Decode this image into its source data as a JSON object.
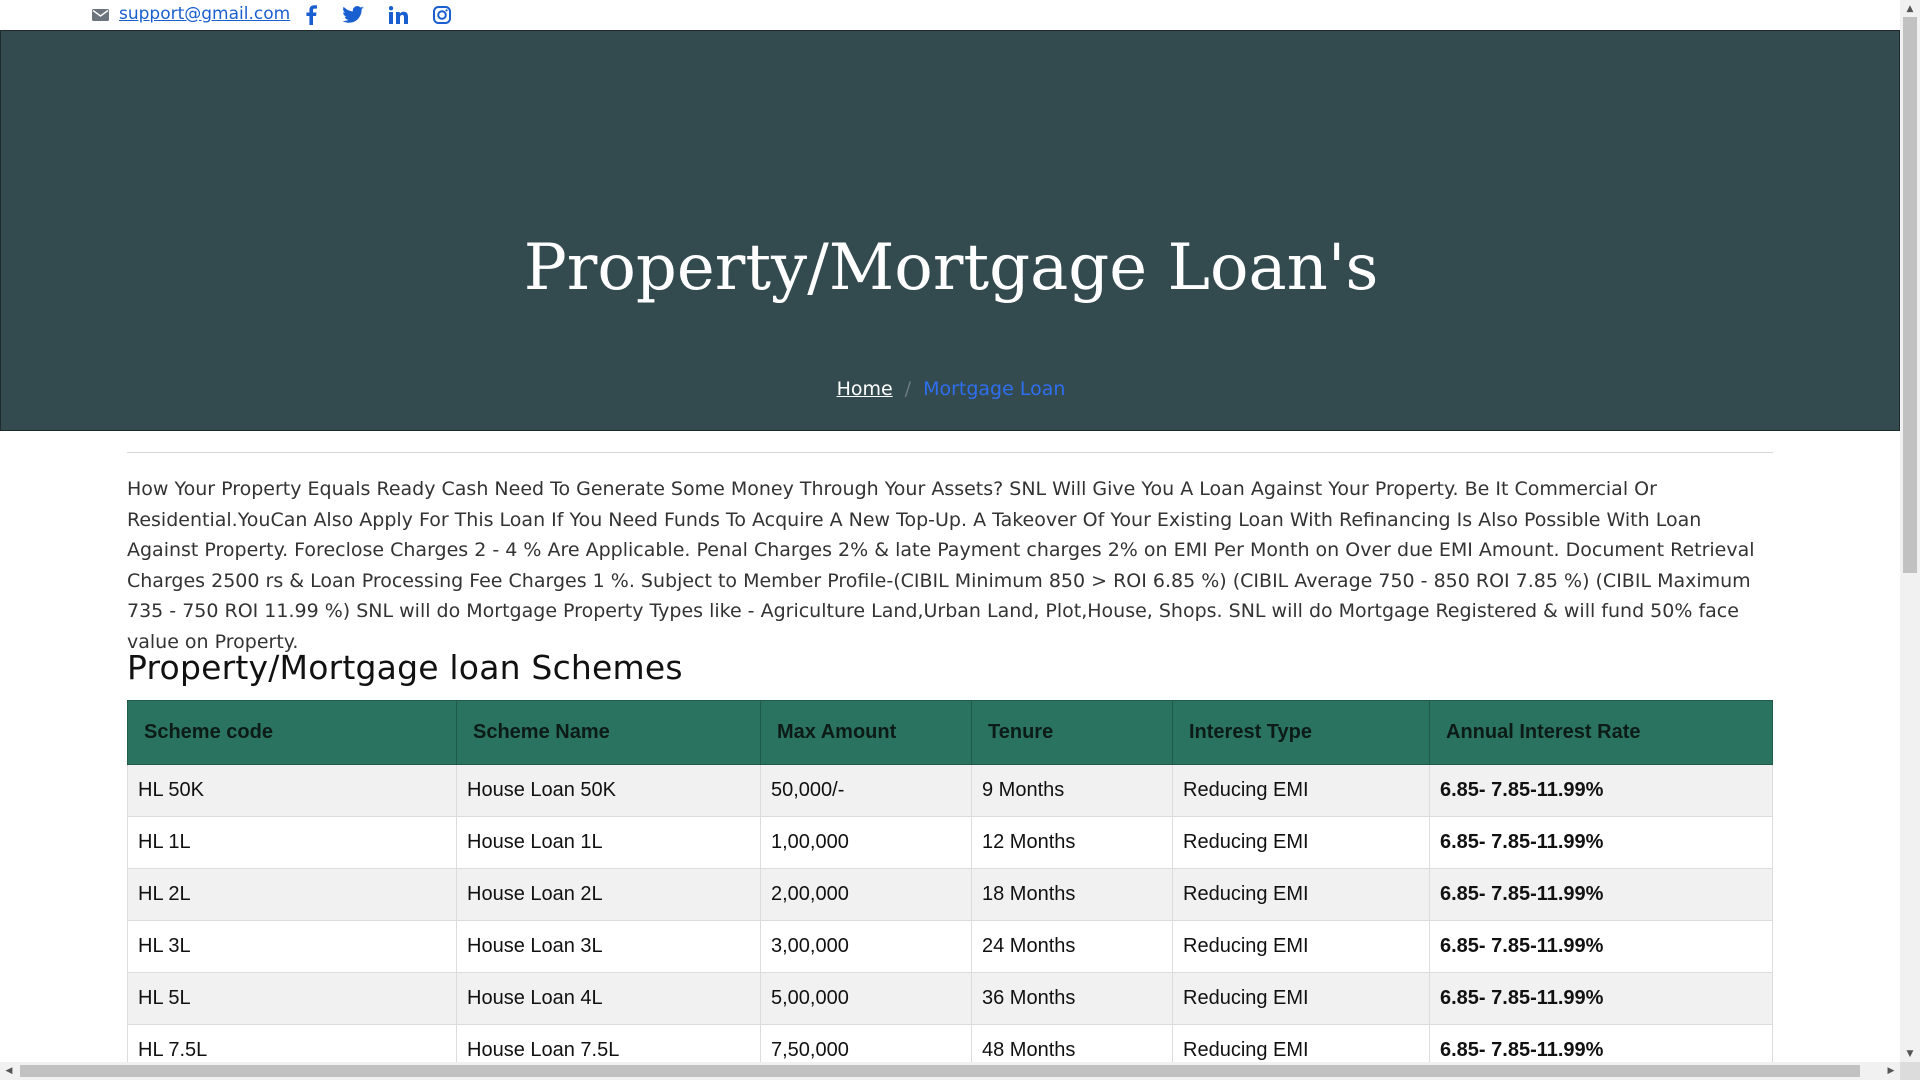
{
  "topbar": {
    "email": "support@gmail.com",
    "social": [
      "facebook-icon",
      "twitter-icon",
      "linkedin-icon",
      "instagram-icon"
    ]
  },
  "hero": {
    "title": "Property/Mortgage Loan's",
    "breadcrumb": {
      "home": "Home",
      "separator": "/",
      "current": "Mortgage Loan"
    },
    "background": "#334a4f"
  },
  "intro": "How Your Property Equals Ready Cash Need To Generate Some Money Through Your Assets? SNL Will Give You A Loan Against Your Property. Be It Commercial Or Residential.YouCan Also Apply For This Loan If You Need Funds To Acquire A New Top-Up. A Takeover Of Your Existing Loan With Refinancing Is Also Possible With Loan Against Property. Foreclose Charges 2 - 4 % Are Applicable. Penal Charges 2% & late Payment charges 2% on EMI Per Month on Over due EMI Amount. Document Retrieval Charges 2500 rs & Loan Processing Fee Charges 1 %. Subject to Member Profile-(CIBIL Minimum 850 > ROI 6.85 %) (CIBIL Average 750 - 850 ROI 7.85 %) (CIBIL Maximum 735 - 750 ROI 11.99 %) SNL will do Mortgage Property Types like - Agriculture Land,Urban Land, Plot,House, Shops. SNL will do Mortgage Registered & will fund 50% face value on Property.",
  "schemes": {
    "title": "Property/Mortgage loan Schemes",
    "header_color": "#2a7360",
    "columns": [
      "Scheme code",
      "Scheme Name",
      "Max Amount",
      "Tenure",
      "Interest Type",
      "Annual Interest Rate"
    ],
    "rows": [
      [
        "HL 50K",
        "House Loan 50K",
        "50,000/-",
        "9 Months",
        "Reducing EMI",
        "6.85- 7.85-11.99%"
      ],
      [
        "HL 1L",
        "House Loan 1L",
        "1,00,000",
        "12 Months",
        "Reducing EMI",
        "6.85- 7.85-11.99%"
      ],
      [
        "HL 2L",
        "House Loan 2L",
        "2,00,000",
        "18 Months",
        "Reducing EMI",
        "6.85- 7.85-11.99%"
      ],
      [
        "HL 3L",
        "House Loan 3L",
        "3,00,000",
        "24 Months",
        "Reducing EMI",
        "6.85- 7.85-11.99%"
      ],
      [
        "HL 5L",
        "House Loan 4L",
        "5,00,000",
        "36 Months",
        "Reducing EMI",
        "6.85- 7.85-11.99%"
      ],
      [
        "HL 7.5L",
        "House Loan 7.5L",
        "7,50,000",
        "48 Months",
        "Reducing EMI",
        "6.85- 7.85-11.99%"
      ]
    ]
  }
}
